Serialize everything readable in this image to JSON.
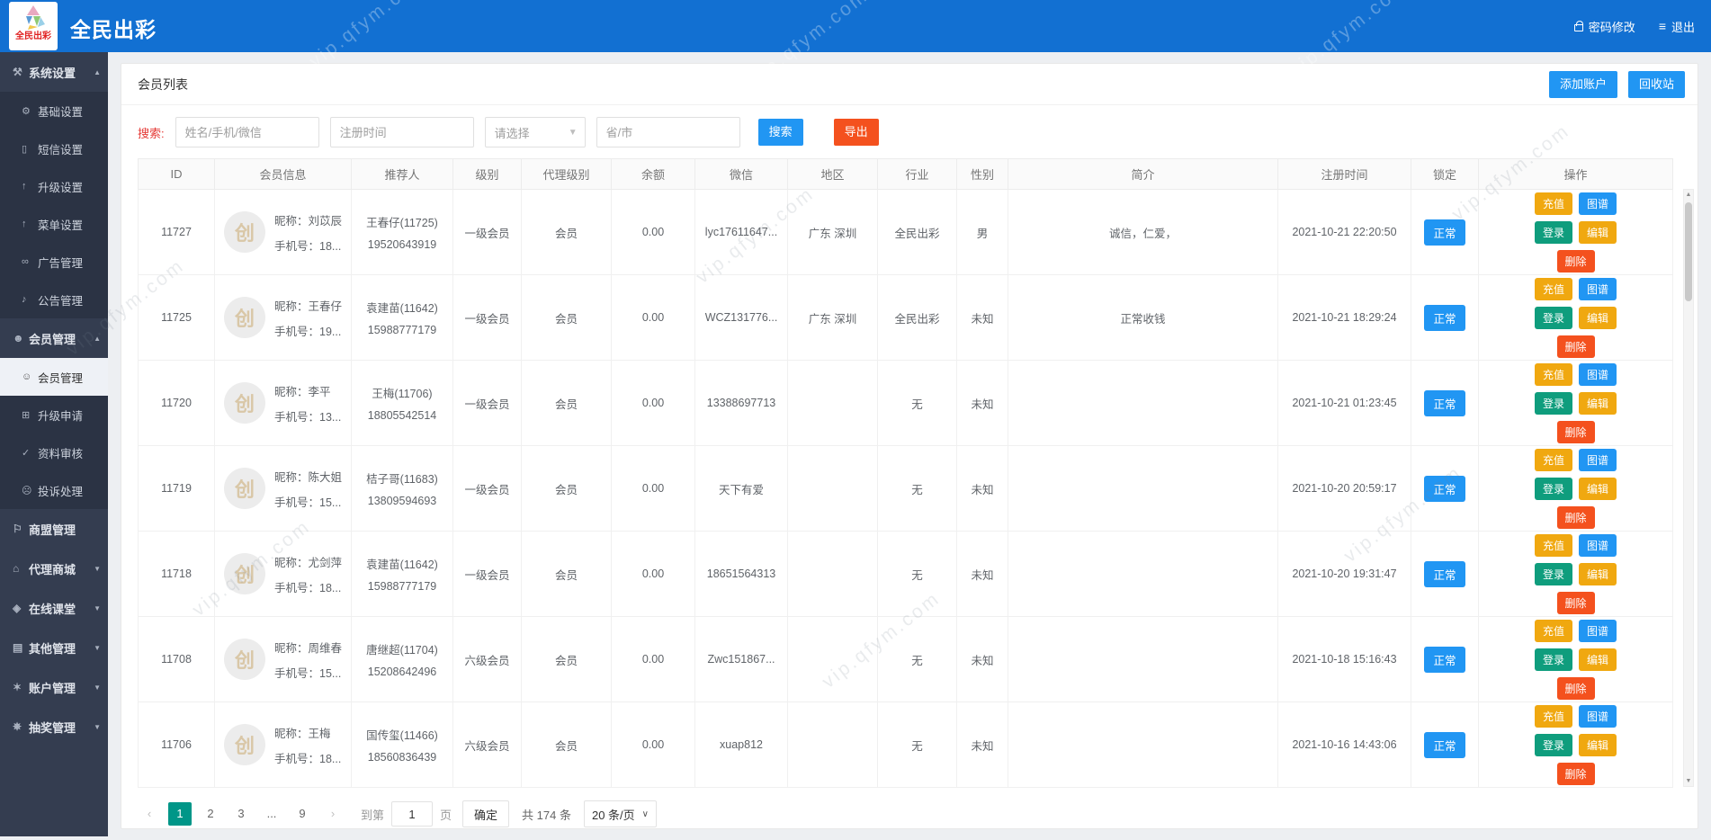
{
  "watermark": {
    "text": "vip.qfym.com"
  },
  "header": {
    "logo_text": "全民出彩",
    "title": "全民出彩",
    "password_label": "密码修改",
    "logout_label": "退出"
  },
  "sidebar": {
    "items": [
      {
        "name": "system-settings",
        "label": "系统设置",
        "icon": "⚒",
        "type": "parent",
        "arrow": "up"
      },
      {
        "name": "basic-settings",
        "label": "基础设置",
        "icon": "⚙",
        "type": "child"
      },
      {
        "name": "sms-settings",
        "label": "短信设置",
        "icon": "▯",
        "type": "child"
      },
      {
        "name": "upgrade-settings",
        "label": "升级设置",
        "icon": "↑",
        "type": "child"
      },
      {
        "name": "menu-settings",
        "label": "菜单设置",
        "icon": "↑",
        "type": "child"
      },
      {
        "name": "ad-management",
        "label": "广告管理",
        "icon": "∞",
        "type": "child"
      },
      {
        "name": "notice-management",
        "label": "公告管理",
        "icon": "♪",
        "type": "child"
      },
      {
        "name": "member-management",
        "label": "会员管理",
        "icon": "☻",
        "type": "parent",
        "arrow": "up"
      },
      {
        "name": "member-list",
        "label": "会员管理",
        "icon": "☺",
        "type": "child",
        "active": true
      },
      {
        "name": "upgrade-apply",
        "label": "升级申请",
        "icon": "⊞",
        "type": "child"
      },
      {
        "name": "data-audit",
        "label": "资料审核",
        "icon": "✓",
        "type": "child"
      },
      {
        "name": "complaint-handle",
        "label": "投诉处理",
        "icon": "☹",
        "type": "child"
      },
      {
        "name": "league-management",
        "label": "商盟管理",
        "icon": "⚐",
        "type": "parent"
      },
      {
        "name": "agent-mall",
        "label": "代理商城",
        "icon": "⌂",
        "type": "parent",
        "arrow": "down"
      },
      {
        "name": "online-classroom",
        "label": "在线课堂",
        "icon": "◈",
        "type": "parent",
        "arrow": "down"
      },
      {
        "name": "other-management",
        "label": "其他管理",
        "icon": "▤",
        "type": "parent",
        "arrow": "down"
      },
      {
        "name": "account-management",
        "label": "账户管理",
        "icon": "✶",
        "type": "parent",
        "arrow": "down"
      },
      {
        "name": "lottery-management",
        "label": "抽奖管理",
        "icon": "✵",
        "type": "parent",
        "arrow": "down"
      }
    ]
  },
  "page": {
    "title": "会员列表",
    "add_button": "添加账户",
    "recycle_button": "回收站"
  },
  "search": {
    "label": "搜索:",
    "name_placeholder": "姓名/手机/微信",
    "time_placeholder": "注册时间",
    "select_placeholder": "请选择",
    "region_placeholder": "省/市",
    "search_button": "搜索",
    "export_button": "导出"
  },
  "table": {
    "columns": [
      "ID",
      "会员信息",
      "推荐人",
      "级别",
      "代理级别",
      "余额",
      "微信",
      "地区",
      "行业",
      "性别",
      "简介",
      "注册时间",
      "锁定",
      "操作"
    ],
    "avatar_char": "创",
    "nick_label": "昵称：",
    "phone_label": "手机号：",
    "actions": [
      {
        "name": "recharge",
        "label": "充值"
      },
      {
        "name": "graph",
        "label": "图谱"
      },
      {
        "name": "login",
        "label": "登录"
      },
      {
        "name": "edit",
        "label": "编辑"
      },
      {
        "name": "delete",
        "label": "删除"
      }
    ],
    "rows": [
      {
        "id": "11727",
        "nick": "刘苡辰",
        "phone": "18...",
        "referrer": "王春仔(11725)",
        "referrer_phone": "19520643919",
        "level": "一级会员",
        "agent_level": "会员",
        "balance": "0.00",
        "wechat": "lyc17611647...",
        "region": "广东 深圳",
        "industry": "全民出彩",
        "gender": "男",
        "intro": "诚信，仁爱，",
        "reg_time": "2021-10-21 22:20:50",
        "lock": "正常"
      },
      {
        "id": "11725",
        "nick": "王春仔",
        "phone": "19...",
        "referrer": "袁建苗(11642)",
        "referrer_phone": "15988777179",
        "level": "一级会员",
        "agent_level": "会员",
        "balance": "0.00",
        "wechat": "WCZ131776...",
        "region": "广东 深圳",
        "industry": "全民出彩",
        "gender": "未知",
        "intro": "正常收钱",
        "reg_time": "2021-10-21 18:29:24",
        "lock": "正常"
      },
      {
        "id": "11720",
        "nick": "李平",
        "phone": "13...",
        "referrer": "王梅(11706)",
        "referrer_phone": "18805542514",
        "level": "一级会员",
        "agent_level": "会员",
        "balance": "0.00",
        "wechat": "13388697713",
        "region": "",
        "industry": "无",
        "gender": "未知",
        "intro": "",
        "reg_time": "2021-10-21 01:23:45",
        "lock": "正常"
      },
      {
        "id": "11719",
        "nick": "陈大姐",
        "phone": "15...",
        "referrer": "桔子哥(11683)",
        "referrer_phone": "13809594693",
        "level": "一级会员",
        "agent_level": "会员",
        "balance": "0.00",
        "wechat": "天下有爱",
        "region": "",
        "industry": "无",
        "gender": "未知",
        "intro": "",
        "reg_time": "2021-10-20 20:59:17",
        "lock": "正常"
      },
      {
        "id": "11718",
        "nick": "尤剑萍",
        "phone": "18...",
        "referrer": "袁建苗(11642)",
        "referrer_phone": "15988777179",
        "level": "一级会员",
        "agent_level": "会员",
        "balance": "0.00",
        "wechat": "18651564313",
        "region": "",
        "industry": "无",
        "gender": "未知",
        "intro": "",
        "reg_time": "2021-10-20 19:31:47",
        "lock": "正常"
      },
      {
        "id": "11708",
        "nick": "周维春",
        "phone": "15...",
        "referrer": "唐继超(11704)",
        "referrer_phone": "15208642496",
        "level": "六级会员",
        "agent_level": "会员",
        "balance": "0.00",
        "wechat": "Zwc151867...",
        "region": "",
        "industry": "无",
        "gender": "未知",
        "intro": "",
        "reg_time": "2021-10-18 15:16:43",
        "lock": "正常"
      },
      {
        "id": "11706",
        "nick": "王梅",
        "phone": "18...",
        "referrer": "国传玺(11466)",
        "referrer_phone": "18560836439",
        "level": "六级会员",
        "agent_level": "会员",
        "balance": "0.00",
        "wechat": "xuap812",
        "region": "",
        "industry": "无",
        "gender": "未知",
        "intro": "",
        "reg_time": "2021-10-16 14:43:06",
        "lock": "正常"
      }
    ]
  },
  "pagination": {
    "prev": "‹",
    "pages": [
      "1",
      "2",
      "3",
      "...",
      "9"
    ],
    "active_page": "1",
    "next": "›",
    "goto_label": "到第",
    "goto_value": "1",
    "page_word": "页",
    "confirm_label": "确定",
    "total_text": "共 174 条",
    "page_size": "20 条/页",
    "caret": "∨"
  }
}
